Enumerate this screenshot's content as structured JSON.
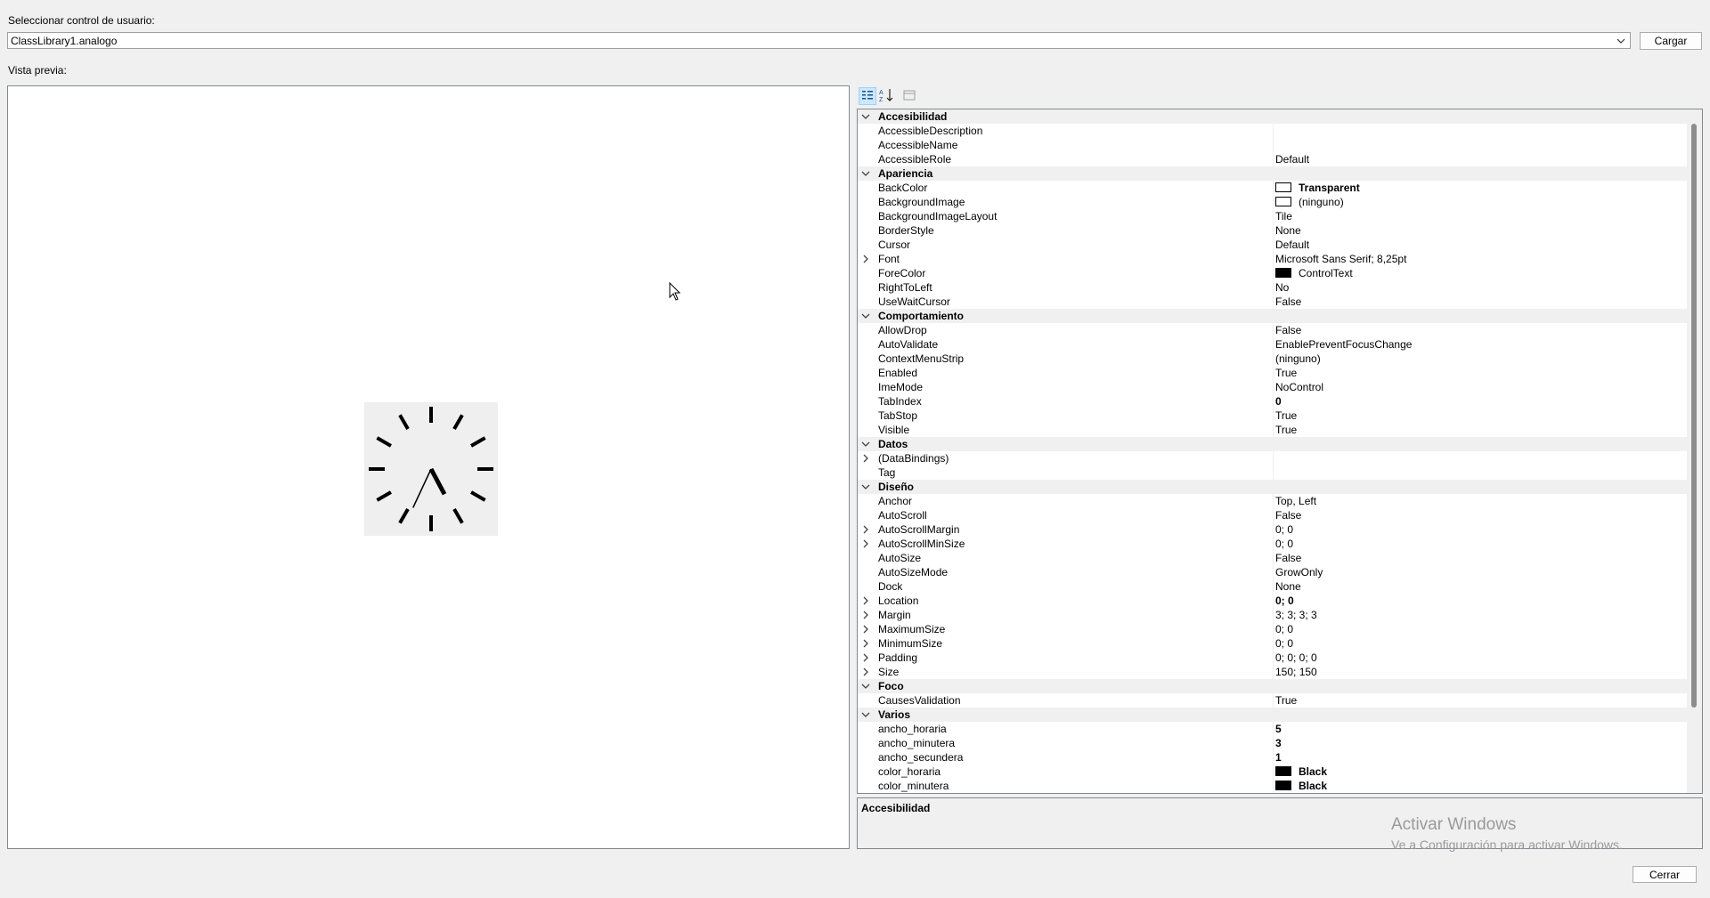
{
  "dialog": {
    "select_label": "Seleccionar control de usuario:",
    "selected_control": "ClassLibrary1.analogo",
    "load_button": "Cargar",
    "preview_label": "Vista previa:",
    "close_button": "Cerrar"
  },
  "toolbar": {
    "buttons": [
      "categorized-icon",
      "alphabetical-icon",
      "property-pages-icon"
    ]
  },
  "property_grid": {
    "rows": [
      {
        "type": "cat",
        "name": "Accesibilidad"
      },
      {
        "type": "prop",
        "name": "AccessibleDescription",
        "value": ""
      },
      {
        "type": "prop",
        "name": "AccessibleName",
        "value": ""
      },
      {
        "type": "prop",
        "name": "AccessibleRole",
        "value": "Default"
      },
      {
        "type": "cat",
        "name": "Apariencia"
      },
      {
        "type": "prop",
        "name": "BackColor",
        "value": "Transparent",
        "swatch": "#ffffff",
        "bold": true
      },
      {
        "type": "prop",
        "name": "BackgroundImage",
        "value": "(ninguno)",
        "swatch": "#ffffff"
      },
      {
        "type": "prop",
        "name": "BackgroundImageLayout",
        "value": "Tile"
      },
      {
        "type": "prop",
        "name": "BorderStyle",
        "value": "None"
      },
      {
        "type": "prop",
        "name": "Cursor",
        "value": "Default"
      },
      {
        "type": "prop",
        "name": "Font",
        "value": "Microsoft Sans Serif; 8,25pt",
        "expand": true
      },
      {
        "type": "prop",
        "name": "ForeColor",
        "value": "ControlText",
        "swatch": "#000000"
      },
      {
        "type": "prop",
        "name": "RightToLeft",
        "value": "No"
      },
      {
        "type": "prop",
        "name": "UseWaitCursor",
        "value": "False"
      },
      {
        "type": "cat",
        "name": "Comportamiento"
      },
      {
        "type": "prop",
        "name": "AllowDrop",
        "value": "False"
      },
      {
        "type": "prop",
        "name": "AutoValidate",
        "value": "EnablePreventFocusChange"
      },
      {
        "type": "prop",
        "name": "ContextMenuStrip",
        "value": "(ninguno)"
      },
      {
        "type": "prop",
        "name": "Enabled",
        "value": "True"
      },
      {
        "type": "prop",
        "name": "ImeMode",
        "value": "NoControl"
      },
      {
        "type": "prop",
        "name": "TabIndex",
        "value": "0",
        "bold": true
      },
      {
        "type": "prop",
        "name": "TabStop",
        "value": "True"
      },
      {
        "type": "prop",
        "name": "Visible",
        "value": "True"
      },
      {
        "type": "cat",
        "name": "Datos"
      },
      {
        "type": "prop",
        "name": "(DataBindings)",
        "value": "",
        "expand": true
      },
      {
        "type": "prop",
        "name": "Tag",
        "value": ""
      },
      {
        "type": "cat",
        "name": "Diseño"
      },
      {
        "type": "prop",
        "name": "Anchor",
        "value": "Top, Left"
      },
      {
        "type": "prop",
        "name": "AutoScroll",
        "value": "False"
      },
      {
        "type": "prop",
        "name": "AutoScrollMargin",
        "value": "0; 0",
        "expand": true
      },
      {
        "type": "prop",
        "name": "AutoScrollMinSize",
        "value": "0; 0",
        "expand": true
      },
      {
        "type": "prop",
        "name": "AutoSize",
        "value": "False"
      },
      {
        "type": "prop",
        "name": "AutoSizeMode",
        "value": "GrowOnly"
      },
      {
        "type": "prop",
        "name": "Dock",
        "value": "None"
      },
      {
        "type": "prop",
        "name": "Location",
        "value": "0; 0",
        "expand": true,
        "bold": true
      },
      {
        "type": "prop",
        "name": "Margin",
        "value": "3; 3; 3; 3",
        "expand": true
      },
      {
        "type": "prop",
        "name": "MaximumSize",
        "value": "0; 0",
        "expand": true
      },
      {
        "type": "prop",
        "name": "MinimumSize",
        "value": "0; 0",
        "expand": true
      },
      {
        "type": "prop",
        "name": "Padding",
        "value": "0; 0; 0; 0",
        "expand": true
      },
      {
        "type": "prop",
        "name": "Size",
        "value": "150; 150",
        "expand": true
      },
      {
        "type": "cat",
        "name": "Foco"
      },
      {
        "type": "prop",
        "name": "CausesValidation",
        "value": "True"
      },
      {
        "type": "cat",
        "name": "Varios"
      },
      {
        "type": "prop",
        "name": "ancho_horaria",
        "value": "5",
        "bold": true
      },
      {
        "type": "prop",
        "name": "ancho_minutera",
        "value": "3",
        "bold": true
      },
      {
        "type": "prop",
        "name": "ancho_secundera",
        "value": "1",
        "bold": true
      },
      {
        "type": "prop",
        "name": "color_horaria",
        "value": "Black",
        "swatch": "#000000",
        "bold": true
      },
      {
        "type": "prop",
        "name": "color_minutera",
        "value": "Black",
        "swatch": "#000000",
        "bold": true
      }
    ]
  },
  "description": {
    "title": "Accesibilidad"
  },
  "watermark": {
    "line1": "Activar Windows",
    "line2": "Ve a Configuración para activar Windows."
  },
  "clock": {
    "hour_hand_angle_deg": 152,
    "minute_hand_angle_deg": 205,
    "tick_count": 12,
    "color": "#000000",
    "background": "#efefef"
  }
}
